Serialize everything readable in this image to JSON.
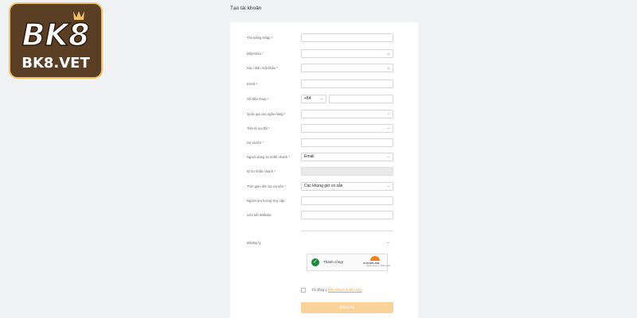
{
  "logo": {
    "primary": "BK8",
    "sub": "BK8.VET",
    "crown": "crown-icon"
  },
  "page_title": "Tạo tài khoản",
  "fields": [
    {
      "label": "Tên Đăng Nhập *",
      "type": "text",
      "value": ""
    },
    {
      "label": "Mật Khẩu *",
      "type": "password",
      "value": "",
      "icon": "eye-icon"
    },
    {
      "label": "Xác nhận mật khẩu *",
      "type": "password",
      "value": "",
      "icon": "eye-icon"
    },
    {
      "label": "Email *",
      "type": "text",
      "value": ""
    },
    {
      "label": "Số điện thoại *",
      "type": "phone",
      "code": "+84",
      "value": ""
    },
    {
      "label": "Quốc gia của ngân hàng *",
      "type": "select",
      "value": ""
    },
    {
      "label": "Tiền tệ ưu đãi *",
      "type": "select",
      "value": ""
    },
    {
      "label": "Họ và tên *",
      "type": "text",
      "value": ""
    },
    {
      "label": "Người dùng tin nhắn nhanh *",
      "type": "select",
      "value": "Email"
    },
    {
      "label": "ID tin nhắn nhanh *",
      "type": "disabled",
      "value": ""
    },
    {
      "label": "Thời gian liên lạc ưu tiên *",
      "type": "select",
      "value": "Các khung giờ có sẵn"
    },
    {
      "label": "Người lưu lượng truy cập",
      "type": "text",
      "value": ""
    },
    {
      "label": "Liên kết Website",
      "type": "text",
      "value": ""
    }
  ],
  "referral": {
    "label": "Mã Đại lý",
    "icon": "chevron-down-icon"
  },
  "captcha": {
    "status": "Thành công!",
    "provider": "CLOUDFLARE",
    "links": "Quyền riêng tư · Điều khoản",
    "icon": "check-icon"
  },
  "terms": {
    "prefix": "Tôi đồng ý",
    "link": "Điều khoản & điều kiện"
  },
  "submit_label": "Đăng ký",
  "colors": {
    "accent": "#f7a935",
    "submit_bg": "#fbd29a",
    "logo_bg": "#5a3f24",
    "logo_border": "#f2c06a",
    "success": "#1d8a3a"
  }
}
